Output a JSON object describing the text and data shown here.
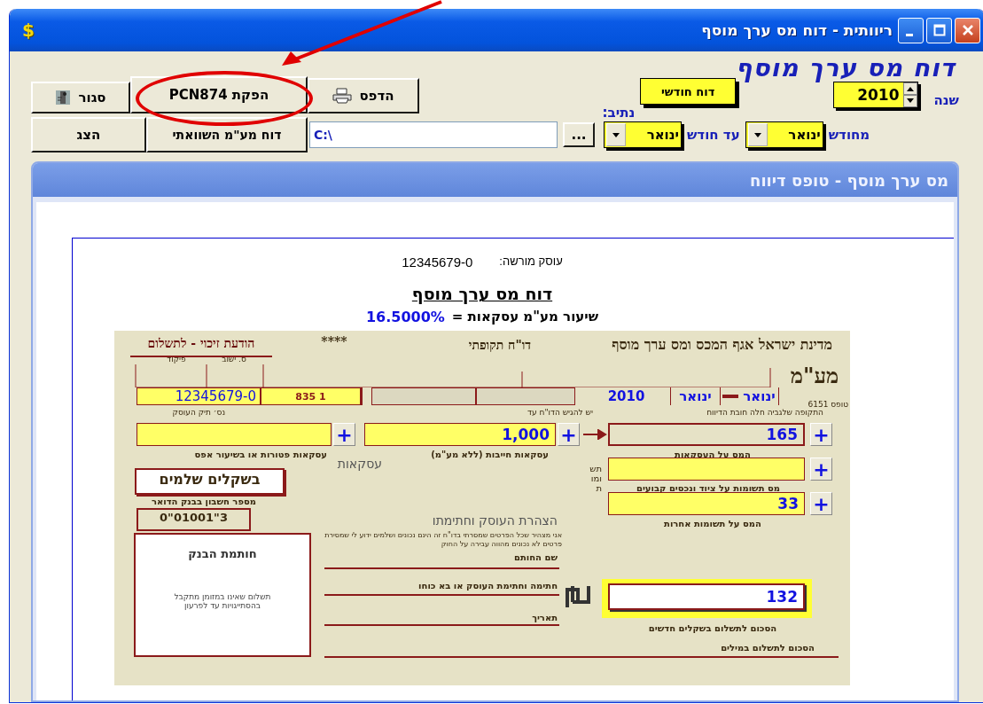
{
  "window": {
    "app_icon": "$",
    "title": "ריוותית - דוח מס ערך מוסף"
  },
  "header_title": "דוח מס ערך מוסף",
  "toolbar": {
    "close_button": "סגור",
    "pcn_button": "הפקת PCN874",
    "print_button": "הדפס",
    "path_label": "נתיב:",
    "monthly_button": "דוח חודשי",
    "year": "2010",
    "year_label": "שנה",
    "show_button": "הצג",
    "compare_button": "דוח מע\"מ השוואתי",
    "path": "C:\\",
    "browse_button": "...",
    "to_month": "ינואר",
    "to_month_label": "עד חודש",
    "from_month": "ינואר",
    "from_month_label": "מחודש"
  },
  "panel": {
    "title": "מס ערך מוסף - טופס דיווח"
  },
  "report": {
    "dealer_label": "עוסק מורשה:",
    "dealer_id": "12345679-0",
    "title": "דוח מס ערך מוסף",
    "rate_label": "שיעור מע\"מ עסקאות =",
    "rate": "16.5000%"
  },
  "form": {
    "agency": "מדינת ישראל אגף המכס ומס ערך מוסף",
    "report_type": "דו\"ח תקופתי",
    "stars": "****",
    "notice": "הודעת זיכוי - לתשלום",
    "logo": "מע\"מ",
    "form_number": "טופס 6151",
    "label_command": "פיקוד",
    "label_settlement": "ס. ישוב",
    "dealer_id": "12345679-0",
    "branch": "835 1",
    "period_year": "2010",
    "period_to": "ינואר",
    "period_from": "ינואר",
    "period_label": "התקופה שלגביה חלה חובת הדיווח",
    "due_label": "יש להגיש הדו\"ח עד",
    "file_label": "נס׳ תיק העוסק",
    "taxable_sales": "1,000",
    "sales_tax": "165",
    "other_input": "33",
    "total": "132",
    "exempt_label": "עסקאות פטורות או בשיעור אפס",
    "taxable_label": "עסקאות חייבות (ללא מע\"מ)",
    "sales_tax_label": "המס על העסקאות",
    "sales_heading": "עסקאות",
    "fixed_assets_label": "מס תשומות על ציוד ונכסים קבועים",
    "other_input_label": "המס על תשומות אחרות",
    "inputs_heading": "תשומות",
    "currency_note": "בשקלים שלמים",
    "bank_account_label": "מספר חשבון בבנק הדואר",
    "bank_account": "0\"01001\"3",
    "declaration_title": "הצהרת העוסק וחתימתו",
    "declaration_text": "אני מצהיר שכל הפרטים שמסרתי בדו\"ח זה הינם נכונים ושלמים ידוע לי שמסירת פרטים לא נכונים מהווה עבירה על החוק",
    "bank_stamp_title": "חותמת הבנק",
    "bank_stamp_note": "תשלום שאינו במזומן מתקבל בהסתייגויות עד לפרעון",
    "signer_label": "שם החותם",
    "signature_label": "חתימה וחתימת העוסק או בא כוחו",
    "date_label": "תאריך",
    "total_label": "הסכום לתשלום בשקלים חדשים",
    "total_words_label": "הסכום לתשלום במילים",
    "plus_buttons": [
      "+",
      "+",
      "+",
      "+",
      "+"
    ]
  }
}
